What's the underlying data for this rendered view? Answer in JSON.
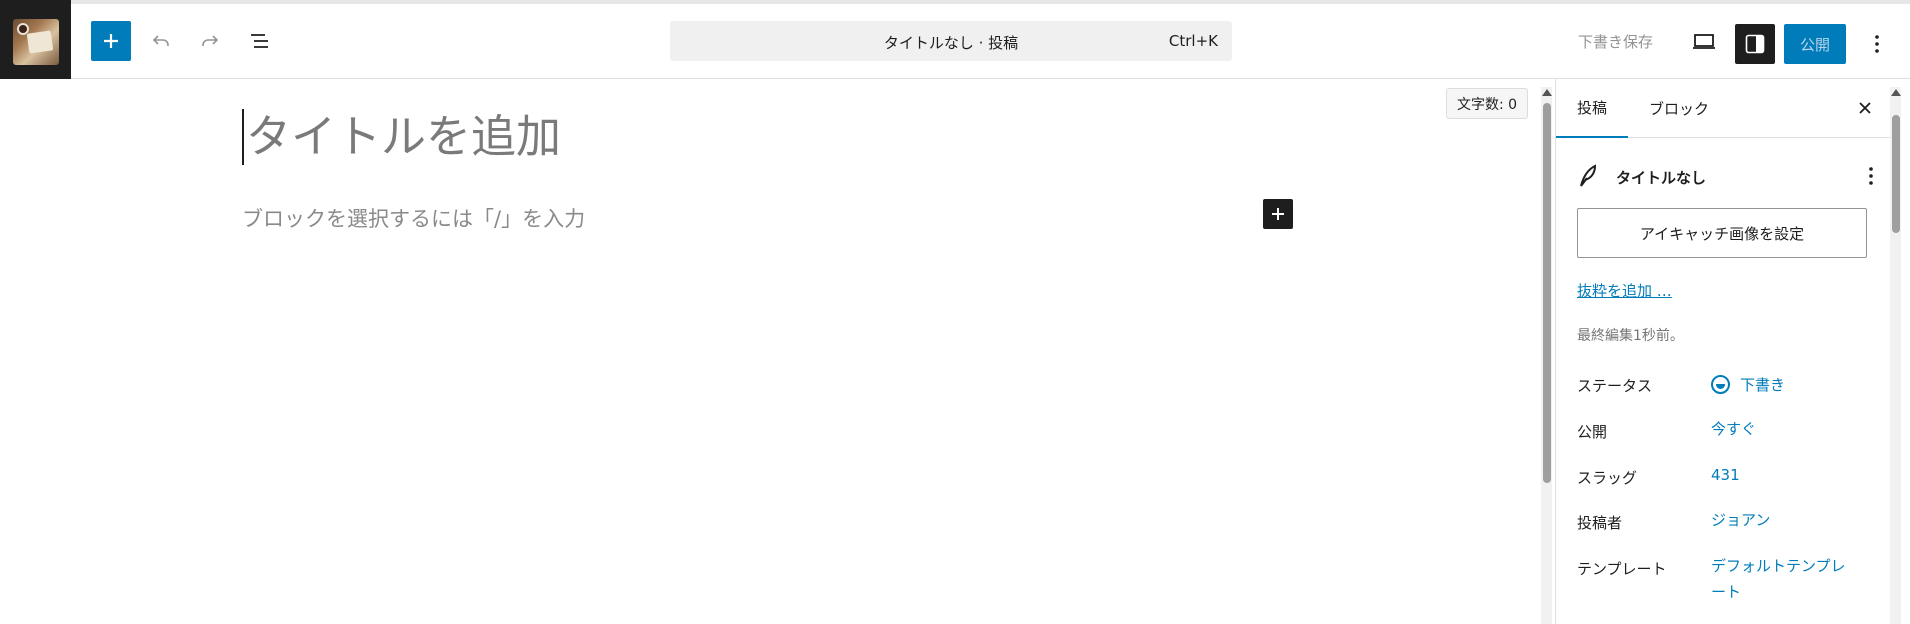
{
  "toolbar": {
    "command_title": "タイトルなし · 投稿",
    "command_shortcut": "Ctrl+K",
    "draft_save": "下書き保存",
    "publish": "公開"
  },
  "editor": {
    "word_count": "文字数: 0",
    "title_placeholder": "タイトルを追加",
    "block_placeholder": "ブロックを選択するには「/」を入力"
  },
  "sidebar": {
    "tabs": [
      {
        "label": "投稿",
        "active": true
      },
      {
        "label": "ブロック",
        "active": false
      }
    ],
    "post_title": "タイトルなし",
    "featured_image_button": "アイキャッチ画像を設定",
    "excerpt_link": "抜粋を追加 …",
    "last_edited": "最終編集1秒前。",
    "meta": [
      {
        "label": "ステータス",
        "value": "下書き"
      },
      {
        "label": "公開",
        "value": "今すぐ"
      },
      {
        "label": "スラッグ",
        "value": "431"
      },
      {
        "label": "投稿者",
        "value": "ジョアン"
      },
      {
        "label": "テンプレート",
        "value": "デフォルトテンプレート"
      }
    ]
  },
  "colors": {
    "accent": "#007cba",
    "dark": "#1e1e1e",
    "muted": "#949494"
  }
}
